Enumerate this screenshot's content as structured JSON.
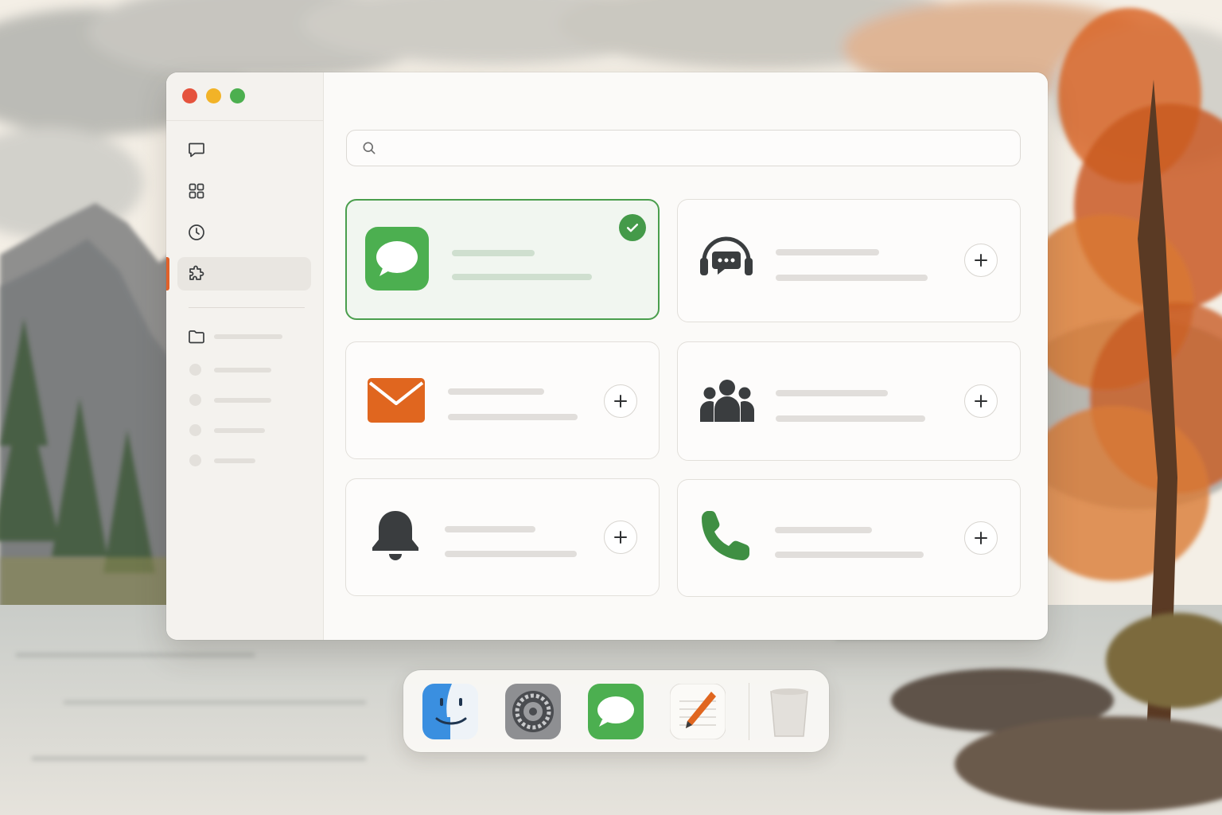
{
  "window": {
    "traffic_lights": {
      "close": "#e5533d",
      "minimize": "#f2b327",
      "zoom": "#4caf4f"
    }
  },
  "sidebar": {
    "nav": [
      {
        "icon": "chat-bubble-icon",
        "active": false
      },
      {
        "icon": "grid-icon",
        "active": false
      },
      {
        "icon": "clock-icon",
        "active": false
      },
      {
        "icon": "puzzle-icon",
        "active": true
      }
    ],
    "accent": "#e0612a",
    "folder": {
      "icon": "folder-icon",
      "label": ""
    },
    "items": [
      "",
      "",
      "",
      ""
    ]
  },
  "search": {
    "value": "",
    "placeholder": ""
  },
  "integrations": [
    {
      "icon": "messages-app-icon",
      "title": "",
      "subtitle": "",
      "status": "added"
    },
    {
      "icon": "support-headset-icon",
      "title": "",
      "subtitle": "",
      "status": "available"
    },
    {
      "icon": "mail-envelope-icon",
      "title": "",
      "subtitle": "",
      "status": "available"
    },
    {
      "icon": "team-people-icon",
      "title": "",
      "subtitle": "",
      "status": "available"
    },
    {
      "icon": "bell-icon",
      "title": "",
      "subtitle": "",
      "status": "available"
    },
    {
      "icon": "phone-icon",
      "title": "",
      "subtitle": "",
      "status": "available"
    }
  ],
  "colors": {
    "selected_border": "#4a9e4d",
    "messages_green": "#4caf50",
    "mail_orange": "#e0661f",
    "phone_green": "#3f8f43",
    "icon_dark": "#3a3d3f"
  },
  "dock": {
    "apps": [
      "finder-icon",
      "system-settings-icon",
      "messages-icon",
      "notes-pencil-icon"
    ],
    "trash": "trash-icon"
  }
}
